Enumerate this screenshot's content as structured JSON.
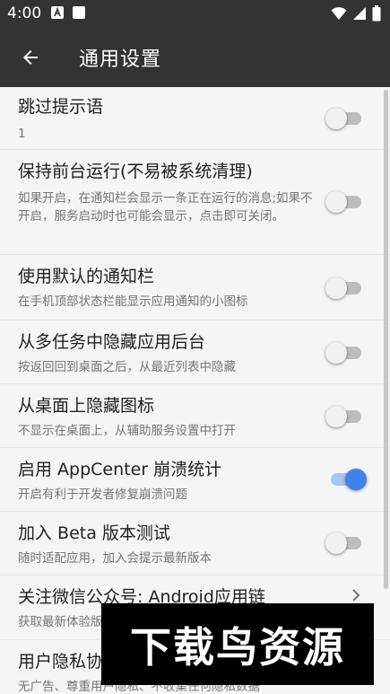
{
  "status_bar": {
    "time": "4:00"
  },
  "app_bar": {
    "title": "通用设置"
  },
  "settings": [
    {
      "title": "跳过提示语",
      "summary": "1",
      "toggle": false
    },
    {
      "title": "保持前台运行(不易被系统清理)",
      "summary": "如果开启，在通知栏会显示一条正在运行的消息;如果不开启，服务启动时也可能会显示，点击即可关闭。",
      "toggle": false
    },
    {
      "title": "使用默认的通知栏",
      "summary": "在手机顶部状态栏能显示应用通知的小图标",
      "toggle": false
    },
    {
      "title": "从多任务中隐藏应用后台",
      "summary": "按返回回到桌面之后，从最近列表中隐藏",
      "toggle": false
    },
    {
      "title": "从桌面上隐藏图标",
      "summary": "不显示在桌面上，从辅助服务设置中打开",
      "toggle": false
    },
    {
      "title": "启用 AppCenter 崩溃统计",
      "summary": "开启有利于开发者修复崩溃问题",
      "toggle": true
    },
    {
      "title": "加入 Beta 版本测试",
      "summary": "随时适配应用，加入会提示最新版本",
      "toggle": false
    },
    {
      "title": "关注微信公众号: Android应用链",
      "summary": "获取最新体验版"
    },
    {
      "title": "用户隐私协",
      "summary": "无广告、尊重用户隐私、不收集任何隐私数据"
    }
  ],
  "watermark": {
    "text": "下载鸟资源"
  },
  "icons": {
    "back": "arrow-left-icon",
    "chevron": "chevron-right-icon",
    "status": [
      "notification-a-icon",
      "notification-square-icon",
      "wifi-icon",
      "signal-icon",
      "battery-icon"
    ]
  },
  "colors": {
    "app_bar": "#333333",
    "accent": "#3f83e8",
    "background": "#f5f5f5"
  }
}
